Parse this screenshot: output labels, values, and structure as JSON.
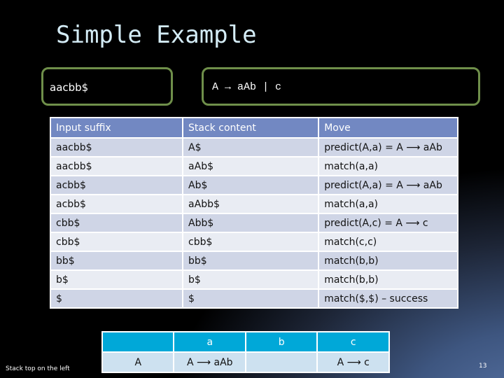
{
  "slide": {
    "title": "Simple Example",
    "input_box": "aacbb$",
    "grammar_box": "A → aAb | c",
    "footnote": "Stack top on the left",
    "page_number": "13"
  },
  "trace_table": {
    "headers": [
      "Input suffix",
      "Stack content",
      "Move"
    ],
    "rows": [
      [
        "aacbb$",
        "A$",
        "predict(A,a) = A ⟶ aAb"
      ],
      [
        "aacbb$",
        "aAb$",
        "match(a,a)"
      ],
      [
        "acbb$",
        "Ab$",
        "predict(A,a) = A ⟶ aAb"
      ],
      [
        "acbb$",
        "aAbb$",
        "match(a,a)"
      ],
      [
        "cbb$",
        "Abb$",
        "predict(A,c) = A ⟶ c"
      ],
      [
        "cbb$",
        "cbb$",
        "match(c,c)"
      ],
      [
        "bb$",
        "bb$",
        "match(b,b)"
      ],
      [
        "b$",
        "b$",
        "match(b,b)"
      ],
      [
        "$",
        "$",
        "match($,$) – success"
      ]
    ]
  },
  "parse_table": {
    "headers": [
      "",
      "a",
      "b",
      "c"
    ],
    "rows": [
      [
        "A",
        "A ⟶ aAb",
        "",
        "A ⟶ c"
      ]
    ]
  },
  "colors": {
    "title": "#d4ecf6",
    "box_border": "#6f8f4a",
    "trace_header": "#7288c2",
    "trace_row_odd": "#cfd5e6",
    "trace_row_even": "#e9ecf3",
    "parse_header": "#00a8d8",
    "parse_cell": "#cde1f0"
  }
}
